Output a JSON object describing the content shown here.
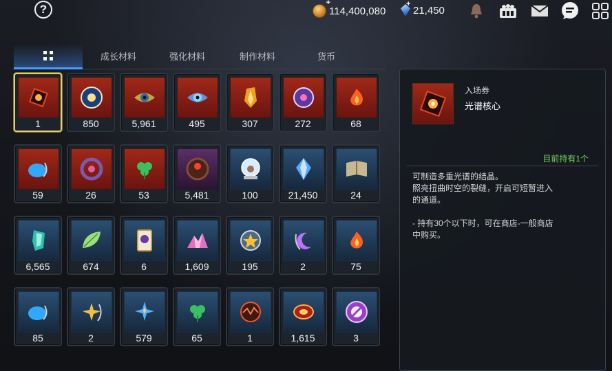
{
  "topbar": {
    "gold": "114,400,080",
    "gems": "21,450",
    "icons": [
      "help-icon",
      "bell-icon",
      "guild-icon",
      "mail-icon",
      "chat-icon",
      "menu-grid-icon"
    ]
  },
  "tabs": [
    {
      "label": "",
      "icon": "grid-icon",
      "active": true
    },
    {
      "label": "成长材料",
      "active": false
    },
    {
      "label": "强化材料",
      "active": false
    },
    {
      "label": "制作材料",
      "active": false
    },
    {
      "label": "货币",
      "active": false
    }
  ],
  "items": [
    {
      "count": "1",
      "icon": "spectrum-core-icon",
      "bg": "red",
      "selected": true
    },
    {
      "count": "850",
      "icon": "sun-medallion-icon",
      "bg": "red"
    },
    {
      "count": "5,961",
      "icon": "golden-eye-icon",
      "bg": "red"
    },
    {
      "count": "495",
      "icon": "blue-eye-icon",
      "bg": "red"
    },
    {
      "count": "307",
      "icon": "amber-crystal-icon",
      "bg": "red"
    },
    {
      "count": "272",
      "icon": "purple-disc-icon",
      "bg": "red"
    },
    {
      "count": "68",
      "icon": "flame-pendant-icon",
      "bg": "red"
    },
    {
      "count": "59",
      "icon": "blue-pendant-icon",
      "bg": "red"
    },
    {
      "count": "26",
      "icon": "purple-ring-icon",
      "bg": "red"
    },
    {
      "count": "53",
      "icon": "clover-pendant-icon",
      "bg": "red"
    },
    {
      "count": "5,481",
      "icon": "red-seal-icon",
      "bg": "purple"
    },
    {
      "count": "100",
      "icon": "snow-globe-icon",
      "bg": "blue"
    },
    {
      "count": "21,450",
      "icon": "blue-gem-icon",
      "bg": "blue"
    },
    {
      "count": "24",
      "icon": "book-icon",
      "bg": "blue"
    },
    {
      "count": "6,565",
      "icon": "teal-crystal-icon",
      "bg": "blue"
    },
    {
      "count": "674",
      "icon": "green-leaf-icon",
      "bg": "blue"
    },
    {
      "count": "6",
      "icon": "card-icon",
      "bg": "blue"
    },
    {
      "count": "1,609",
      "icon": "pink-crystal-icon",
      "bg": "blue"
    },
    {
      "count": "195",
      "icon": "star-medallion-icon",
      "bg": "blue"
    },
    {
      "count": "2",
      "icon": "moon-pendant-icon",
      "bg": "blue"
    },
    {
      "count": "75",
      "icon": "flame-pendant-icon",
      "bg": "blue"
    },
    {
      "count": "85",
      "icon": "blue-pendant-icon",
      "bg": "blue"
    },
    {
      "count": "2",
      "icon": "star-pendant-icon",
      "bg": "blue"
    },
    {
      "count": "579",
      "icon": "blue-star-pendant-icon",
      "bg": "blue"
    },
    {
      "count": "65",
      "icon": "clover-pendant-icon",
      "bg": "blue"
    },
    {
      "count": "1",
      "icon": "lava-orb-icon",
      "bg": "blue"
    },
    {
      "count": "1,615",
      "icon": "red-bracelet-icon",
      "bg": "blue"
    },
    {
      "count": "3",
      "icon": "purple-badge-icon",
      "bg": "blue"
    }
  ],
  "detail": {
    "category": "入场券",
    "name": "光谱核心",
    "owned": "目前持有1个",
    "desc_lines": [
      "可制造多重光谱的结晶。",
      "照亮扭曲时空的裂缝，开启可短暂进入",
      "的通道。"
    ],
    "desc_note_lines": [
      "- 持有30个以下时，可在商店-一般商店",
      "中购买。"
    ]
  },
  "colors": {
    "accent": "#4a9cff",
    "owned": "#6ed05a",
    "selected_border": "#e3d17a",
    "red_slot": "#8a1e14",
    "blue_slot": "#21405d"
  }
}
